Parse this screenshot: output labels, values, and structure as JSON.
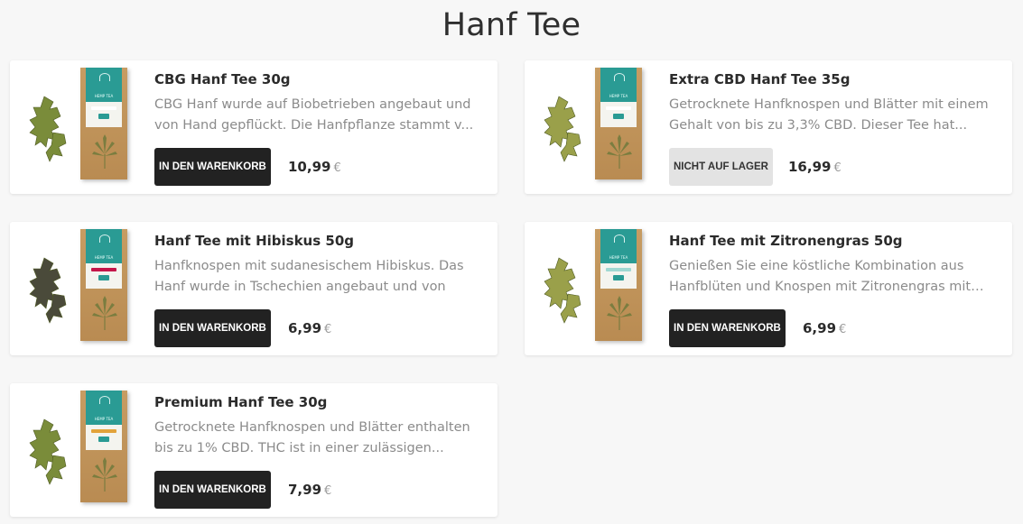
{
  "page": {
    "title": "Hanf Tee"
  },
  "colors": {
    "accent": "#2a9b94",
    "button_dark": "#222222",
    "button_disabled": "#e3e3e3"
  },
  "products": [
    {
      "name": "CBG Hanf Tee 30g",
      "description": "CBG Hanf wurde auf Biobetrieben angebaut und von Hand gepflückt. Die Hanfpflanze stammt v...",
      "button": "IN DEN WARENKORB",
      "available": true,
      "price": "10,99",
      "currency": "€",
      "label_color": "#ffffff"
    },
    {
      "name": "Extra CBD Hanf Tee 35g",
      "description": "Getrocknete Hanfknospen und Blätter mit einem Gehalt von bis zu 3,3% CBD. Dieser Tee hat...",
      "button": "NICHT AUF LAGER",
      "available": false,
      "price": "16,99",
      "currency": "€",
      "label_color": "#ffffff"
    },
    {
      "name": "Hanf Tee mit Hibiskus 50g",
      "description": "Hanfknospen mit sudanesischem Hibiskus. Das Hanf wurde in Tschechien angebaut und von",
      "button": "IN DEN WARENKORB",
      "available": true,
      "price": "6,99",
      "currency": "€",
      "label_color": "#c4164a"
    },
    {
      "name": "Hanf Tee mit Zitronengras 50g",
      "description": "Genießen Sie eine köstliche Kombination aus Hanfblüten und Knospen mit Zitronengras mit b...",
      "button": "IN DEN WARENKORB",
      "available": true,
      "price": "6,99",
      "currency": "€",
      "label_color": "#9fd8d2"
    },
    {
      "name": "Premium Hanf Tee 30g",
      "description": "Getrocknete Hanfknospen und Blätter enthalten bis zu 1% CBD. THC ist in einer zulässigen...",
      "button": "IN DEN WARENKORB",
      "available": true,
      "price": "7,99",
      "currency": "€",
      "label_color": "#e2a33a"
    }
  ]
}
